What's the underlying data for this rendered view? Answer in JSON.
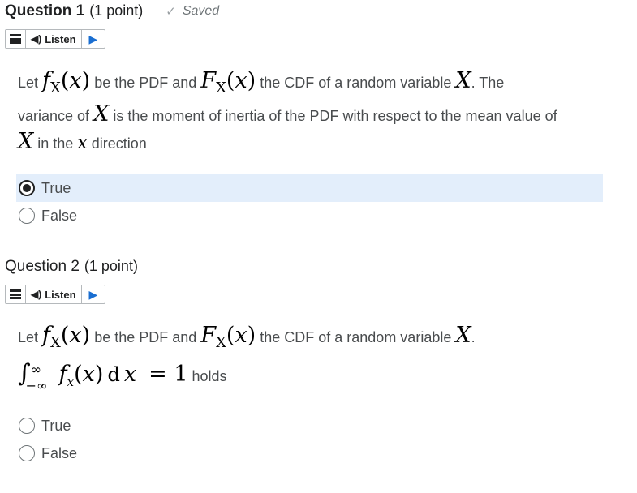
{
  "q1": {
    "title": "Question 1",
    "points": "(1 point)",
    "saved": "Saved",
    "listen_label": "Listen",
    "text": {
      "let": "Let",
      "f": "f",
      "X": "X",
      "x": "x",
      "be_pdf": "be the PDF and",
      "F": "F",
      "the_cdf": "the CDF of a random variable",
      "the": ". The",
      "variance_of": "variance of",
      "moment": "is the moment of inertia of the PDF with respect to the mean value of",
      "in_the": "in the",
      "direction": "direction"
    },
    "options": [
      {
        "label": "True",
        "selected": true
      },
      {
        "label": "False",
        "selected": false
      }
    ]
  },
  "q2": {
    "title": "Question 2",
    "points": "(1 point)",
    "listen_label": "Listen",
    "text": {
      "let": "Let",
      "f": "f",
      "X": "X",
      "x": "x",
      "be_pdf": "be the PDF and",
      "F": "F",
      "the_cdf": "the CDF of a random variable",
      "period": ".",
      "integral": "∫",
      "upper": "∞",
      "lower": "−∞",
      "d": "d",
      "equals_one": "= 1",
      "holds": "holds"
    },
    "options": [
      {
        "label": "True",
        "selected": false
      },
      {
        "label": "False",
        "selected": false
      }
    ]
  }
}
